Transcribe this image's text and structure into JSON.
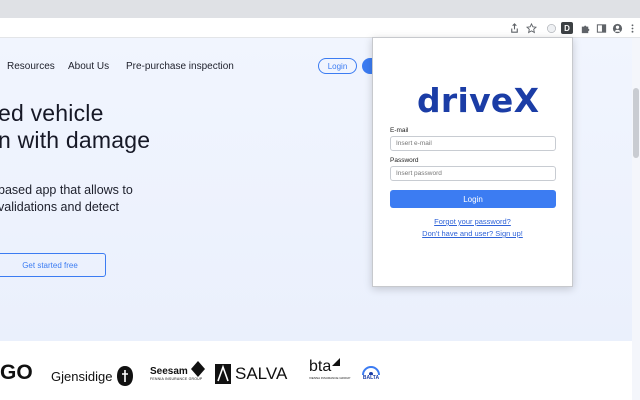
{
  "browser": {
    "toolbar_icons": [
      "share-icon",
      "star-icon",
      "extension-circle-icon",
      "drivex-extension-icon",
      "puzzle-icon",
      "side-panel-icon",
      "profile-icon",
      "kebab-menu-icon"
    ],
    "drivex_badge": "D"
  },
  "site": {
    "nav": {
      "resources": "Resources",
      "about": "About Us",
      "inspection": "Pre-purchase inspection",
      "login": "Login"
    },
    "hero": {
      "line1": "ed vehicle",
      "line2": "n with damage",
      "sub1": "based app that allows to",
      "sub2": "validations and detect",
      "cta": "Get started free"
    },
    "partners": {
      "go": "GO",
      "gjensidige": "Gjensidige",
      "seesam": "Seesam",
      "seesam_tag": "FENNIA INSURANCE GROUP",
      "salva": "SALVA",
      "bta": "bta",
      "bta_tag": "VIENNA INSURANCE GROUP",
      "balta": "BALTA"
    }
  },
  "popup": {
    "brand": "driveX",
    "email_label": "E-mail",
    "email_placeholder": "Insert e-mail",
    "password_label": "Password",
    "password_placeholder": "Insert password",
    "login_button": "Login",
    "forgot_link": "Forgot your password?",
    "signup_link": "Don't have and user? Sign up!"
  },
  "colors": {
    "accent": "#3c7cf2",
    "brand": "#1b3da6"
  }
}
